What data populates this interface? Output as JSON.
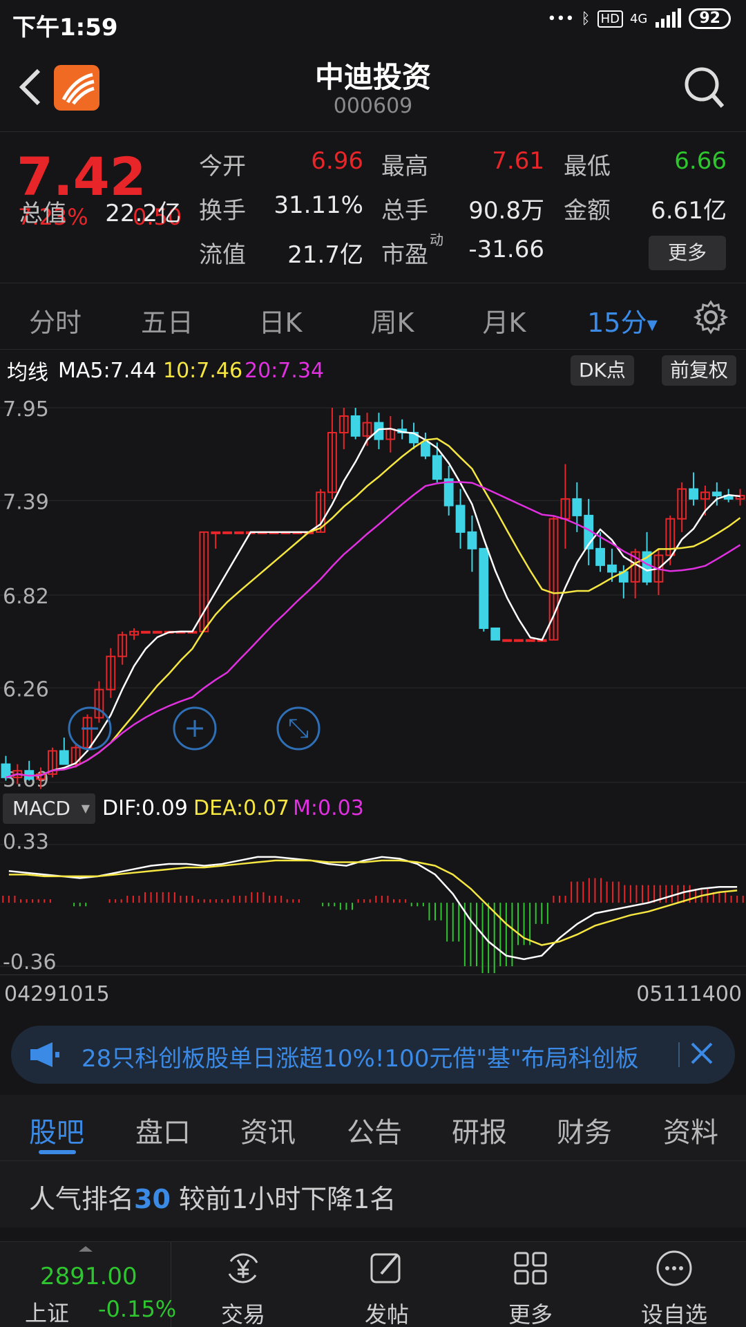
{
  "status": {
    "time": "下午1:59",
    "network": "4G",
    "battery": "92"
  },
  "header": {
    "name": "中迪投资",
    "code": "000609"
  },
  "quote": {
    "price": "7.42",
    "pct": "7.23%",
    "change": "0.50",
    "total_mv_label": "总值",
    "total_mv": "22.2亿",
    "open_label": "今开",
    "open": "6.96",
    "high_label": "最高",
    "high": "7.61",
    "low_label": "最低",
    "low": "6.66",
    "turnover_label": "换手",
    "turnover": "31.11%",
    "volume_label": "总手",
    "volume": "90.8万",
    "amount_label": "金额",
    "amount": "6.61亿",
    "float_mv_label": "流值",
    "float_mv": "21.7亿",
    "pe_label": "市盈",
    "pe_sup": "动",
    "pe": "-31.66",
    "more": "更多"
  },
  "period_tabs": [
    "分时",
    "五日",
    "日K",
    "周K",
    "月K",
    "15分"
  ],
  "ma": {
    "label": "均线",
    "ma5": "MA5:7.44",
    "ma10": "10:7.46",
    "ma20": "20:7.34",
    "dk": "DK点",
    "adjust": "前复权"
  },
  "macd": {
    "select": "MACD",
    "dif": "DIF:0.09",
    "dea": "DEA:0.07",
    "m": "M:0.03"
  },
  "time_axis": {
    "start": "04291015",
    "end": "05111400"
  },
  "banner": {
    "text": "28只科创板股单日涨超10%!100元借\"基\"布局科创板"
  },
  "info_tabs": [
    "股吧",
    "盘口",
    "资讯",
    "公告",
    "研报",
    "财务",
    "资料"
  ],
  "rank": {
    "prefix": "人气排名",
    "num": "30",
    "suffix": " 较前1小时下降1名"
  },
  "bottom": {
    "index_value": "2891.00",
    "index_name": "上证",
    "index_pct": "-0.15%",
    "nav": [
      "交易",
      "发帖",
      "更多",
      "设自选"
    ]
  },
  "colors": {
    "up": "#e8262a",
    "down": "#2ec62e",
    "accent": "#3a8ae6",
    "candle_down": "#3fd3e6",
    "ma10": "#f5e642",
    "ma20": "#e030e0"
  },
  "chart_data": [
    {
      "type": "candlestick",
      "title": "",
      "ylim": [
        5.69,
        7.95
      ],
      "yticks": [
        "7.95",
        "7.39",
        "6.82",
        "6.26",
        "5.69"
      ],
      "grid": true,
      "legend": "top-left",
      "candles": [
        [
          5.8,
          5.85,
          5.7,
          5.72
        ],
        [
          5.72,
          5.8,
          5.68,
          5.76
        ],
        [
          5.76,
          5.82,
          5.7,
          5.71
        ],
        [
          5.71,
          5.78,
          5.65,
          5.74
        ],
        [
          5.74,
          5.9,
          5.72,
          5.88
        ],
        [
          5.88,
          5.96,
          5.84,
          5.8
        ],
        [
          5.8,
          5.92,
          5.78,
          5.9
        ],
        [
          5.9,
          6.1,
          5.88,
          6.08
        ],
        [
          6.08,
          6.3,
          6.05,
          6.25
        ],
        [
          6.25,
          6.5,
          6.2,
          6.45
        ],
        [
          6.45,
          6.6,
          6.4,
          6.58
        ],
        [
          6.58,
          6.62,
          6.55,
          6.6
        ],
        [
          6.6,
          6.6,
          6.6,
          6.6
        ],
        [
          6.6,
          6.6,
          6.6,
          6.6
        ],
        [
          6.6,
          6.6,
          6.6,
          6.6
        ],
        [
          6.6,
          6.6,
          6.6,
          6.6
        ],
        [
          6.6,
          6.6,
          6.6,
          6.6
        ],
        [
          6.6,
          7.2,
          6.6,
          7.2
        ],
        [
          7.2,
          7.2,
          7.1,
          7.2
        ],
        [
          7.2,
          7.2,
          7.2,
          7.2
        ],
        [
          7.2,
          7.2,
          7.2,
          7.2
        ],
        [
          7.2,
          7.2,
          7.2,
          7.2
        ],
        [
          7.2,
          7.2,
          7.2,
          7.2
        ],
        [
          7.2,
          7.2,
          7.2,
          7.2
        ],
        [
          7.2,
          7.2,
          7.2,
          7.2
        ],
        [
          7.2,
          7.2,
          7.2,
          7.2
        ],
        [
          7.2,
          7.2,
          7.2,
          7.2
        ],
        [
          7.2,
          7.46,
          7.2,
          7.44
        ],
        [
          7.44,
          7.95,
          7.4,
          7.8
        ],
        [
          7.8,
          7.95,
          7.7,
          7.9
        ],
        [
          7.9,
          7.95,
          7.76,
          7.78
        ],
        [
          7.78,
          7.92,
          7.72,
          7.86
        ],
        [
          7.86,
          7.92,
          7.7,
          7.76
        ],
        [
          7.76,
          7.9,
          7.68,
          7.82
        ],
        [
          7.82,
          7.88,
          7.76,
          7.8
        ],
        [
          7.8,
          7.86,
          7.7,
          7.74
        ],
        [
          7.74,
          7.8,
          7.64,
          7.66
        ],
        [
          7.66,
          7.74,
          7.5,
          7.52
        ],
        [
          7.52,
          7.6,
          7.3,
          7.36
        ],
        [
          7.36,
          7.46,
          7.1,
          7.2
        ],
        [
          7.2,
          7.3,
          6.96,
          7.1
        ],
        [
          7.1,
          7.1,
          6.6,
          6.62
        ],
        [
          6.62,
          6.62,
          6.55,
          6.55
        ],
        [
          6.55,
          6.55,
          6.55,
          6.55
        ],
        [
          6.55,
          6.55,
          6.55,
          6.55
        ],
        [
          6.55,
          6.55,
          6.55,
          6.55
        ],
        [
          6.55,
          6.55,
          6.55,
          6.55
        ],
        [
          6.55,
          7.3,
          6.55,
          7.28
        ],
        [
          7.28,
          7.61,
          7.1,
          7.4
        ],
        [
          7.4,
          7.5,
          7.2,
          7.3
        ],
        [
          7.3,
          7.4,
          7.0,
          7.1
        ],
        [
          7.1,
          7.2,
          6.96,
          7.0
        ],
        [
          7.0,
          7.1,
          6.9,
          6.96
        ],
        [
          6.96,
          7.0,
          6.8,
          6.9
        ],
        [
          6.9,
          7.1,
          6.8,
          7.08
        ],
        [
          7.08,
          7.2,
          6.88,
          6.9
        ],
        [
          6.9,
          7.1,
          6.82,
          7.06
        ],
        [
          7.06,
          7.3,
          7.0,
          7.28
        ],
        [
          7.28,
          7.5,
          7.2,
          7.46
        ],
        [
          7.46,
          7.56,
          7.36,
          7.4
        ],
        [
          7.4,
          7.48,
          7.3,
          7.44
        ],
        [
          7.44,
          7.5,
          7.36,
          7.42
        ],
        [
          7.42,
          7.46,
          7.38,
          7.4
        ],
        [
          7.4,
          7.46,
          7.36,
          7.42
        ]
      ]
    },
    {
      "type": "line",
      "title": "MACD",
      "ylim": [
        -0.36,
        0.33
      ],
      "yticks": [
        "0.33",
        "-0.36"
      ],
      "series": [
        {
          "name": "DIF",
          "values": [
            0.18,
            0.17,
            0.16,
            0.15,
            0.14,
            0.15,
            0.17,
            0.19,
            0.21,
            0.22,
            0.22,
            0.21,
            0.22,
            0.24,
            0.26,
            0.26,
            0.25,
            0.24,
            0.22,
            0.21,
            0.24,
            0.26,
            0.25,
            0.22,
            0.16,
            0.05,
            -0.1,
            -0.22,
            -0.3,
            -0.32,
            -0.3,
            -0.2,
            -0.12,
            -0.06,
            -0.04,
            -0.02,
            0.0,
            0.03,
            0.06,
            0.08,
            0.09,
            0.09
          ]
        },
        {
          "name": "DEA",
          "values": [
            0.16,
            0.16,
            0.15,
            0.15,
            0.15,
            0.15,
            0.16,
            0.17,
            0.18,
            0.19,
            0.2,
            0.2,
            0.21,
            0.22,
            0.23,
            0.24,
            0.24,
            0.24,
            0.23,
            0.23,
            0.23,
            0.24,
            0.24,
            0.23,
            0.21,
            0.16,
            0.08,
            -0.02,
            -0.12,
            -0.2,
            -0.24,
            -0.22,
            -0.18,
            -0.13,
            -0.1,
            -0.07,
            -0.05,
            -0.02,
            0.01,
            0.04,
            0.06,
            0.07
          ]
        }
      ]
    }
  ]
}
